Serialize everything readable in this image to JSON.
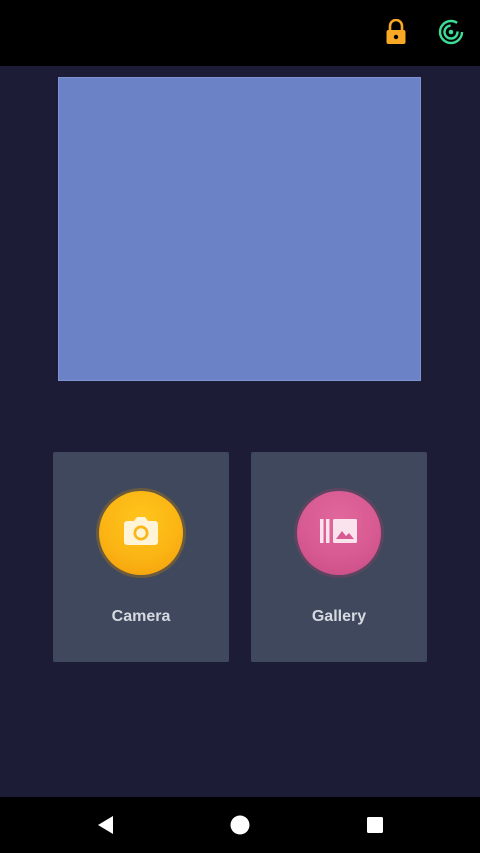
{
  "status_bar": {
    "icons": [
      "lock-icon",
      "spiral-icon"
    ],
    "lock_color": "#f9a826",
    "spiral_color": "#3ddc97"
  },
  "main": {
    "preview_color": "#6b82c6",
    "tiles": [
      {
        "label": "Camera",
        "icon": "camera-icon",
        "color": "#fbb514"
      },
      {
        "label": "Gallery",
        "icon": "gallery-icon",
        "color": "#d85a92"
      }
    ]
  },
  "nav_bar": {
    "buttons": [
      "back-icon",
      "home-icon",
      "recents-icon"
    ]
  }
}
